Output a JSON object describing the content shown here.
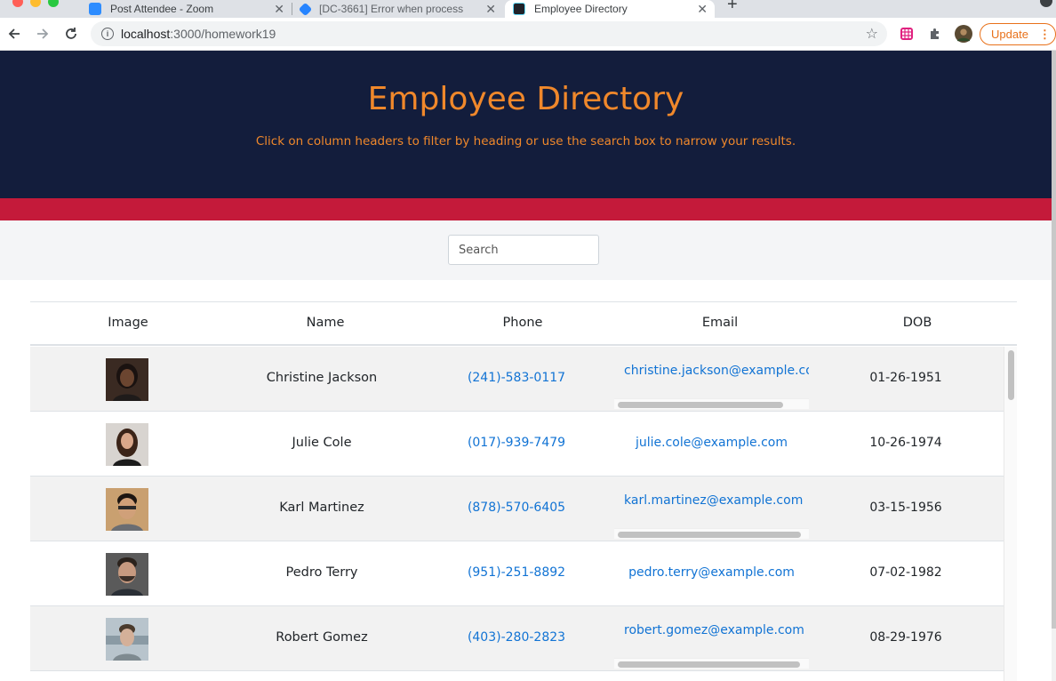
{
  "browser": {
    "tabs": [
      {
        "label": "Post Attendee - Zoom",
        "favicon": "zoom-icon",
        "active": false
      },
      {
        "label": "[DC-3661] Error when process",
        "favicon": "jira-icon",
        "active": false
      },
      {
        "label": "Employee Directory",
        "favicon": "react-icon",
        "active": true
      }
    ],
    "url_host": "localhost",
    "url_rest": ":3000/homework19",
    "update_label": "Update"
  },
  "hero": {
    "title": "Employee Directory",
    "subtitle": "Click on column headers to filter by heading or use the search box to narrow your results."
  },
  "search": {
    "placeholder": "Search",
    "value": ""
  },
  "table": {
    "headers": [
      "Image",
      "Name",
      "Phone",
      "Email",
      "DOB"
    ],
    "rows": [
      {
        "name": "Christine Jackson",
        "phone": "(241)-583-0117",
        "email": "christine.jackson@example.com",
        "dob": "01-26-1951"
      },
      {
        "name": "Julie Cole",
        "phone": "(017)-939-7479",
        "email": "julie.cole@example.com",
        "dob": "10-26-1974"
      },
      {
        "name": "Karl Martinez",
        "phone": "(878)-570-6405",
        "email": "karl.martinez@example.com",
        "dob": "03-15-1956"
      },
      {
        "name": "Pedro Terry",
        "phone": "(951)-251-8892",
        "email": "pedro.terry@example.com",
        "dob": "07-02-1982"
      },
      {
        "name": "Robert Gomez",
        "phone": "(403)-280-2823",
        "email": "robert.gomez@example.com",
        "dob": "08-29-1976"
      }
    ]
  },
  "colors": {
    "hero_bg": "#131d3c",
    "accent_orange": "#f0882b",
    "stripe_red": "#c41a3a",
    "link_blue": "#1173d4"
  }
}
